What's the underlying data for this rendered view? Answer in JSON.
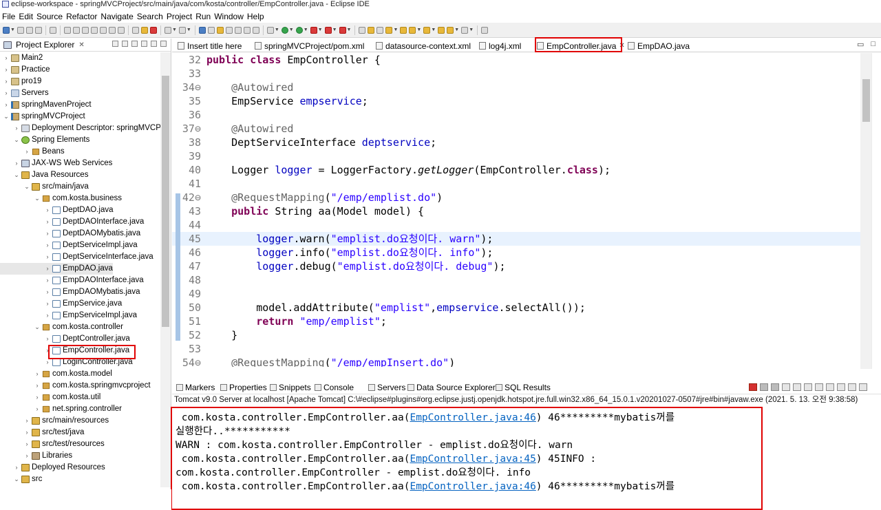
{
  "window": {
    "title": "eclipse-workspace - springMVCProject/src/main/java/com/kosta/controller/EmpController.java - Eclipse IDE"
  },
  "menu": [
    "File",
    "Edit",
    "Source",
    "Refactor",
    "Navigate",
    "Search",
    "Project",
    "Run",
    "Window",
    "Help"
  ],
  "explorer": {
    "tab_label": "Project Explorer",
    "items": [
      {
        "label": "Main2",
        "depth": 0,
        "twisty": "›",
        "icon": "proj"
      },
      {
        "label": "Practice",
        "depth": 0,
        "twisty": "›",
        "icon": "proj"
      },
      {
        "label": "pro19",
        "depth": 0,
        "twisty": "›",
        "icon": "proj"
      },
      {
        "label": "Servers",
        "depth": 0,
        "twisty": "›",
        "icon": "srv"
      },
      {
        "label": "springMavenProject",
        "depth": 0,
        "twisty": "›",
        "icon": "proj2"
      },
      {
        "label": "springMVCProject",
        "depth": 0,
        "twisty": "⌄",
        "icon": "proj2"
      },
      {
        "label": "Deployment Descriptor: springMVCPr",
        "depth": 1,
        "twisty": "›",
        "icon": "desc"
      },
      {
        "label": "Spring Elements",
        "depth": 1,
        "twisty": "⌄",
        "icon": "spr"
      },
      {
        "label": "Beans",
        "depth": 2,
        "twisty": "›",
        "icon": "pkg"
      },
      {
        "label": "JAX-WS Web Services",
        "depth": 1,
        "twisty": "›",
        "icon": "ws"
      },
      {
        "label": "Java Resources",
        "depth": 1,
        "twisty": "⌄",
        "icon": "src"
      },
      {
        "label": "src/main/java",
        "depth": 2,
        "twisty": "⌄",
        "icon": "src"
      },
      {
        "label": "com.kosta.business",
        "depth": 3,
        "twisty": "⌄",
        "icon": "pkg"
      },
      {
        "label": "DeptDAO.java",
        "depth": 4,
        "twisty": "›",
        "icon": "jv"
      },
      {
        "label": "DeptDAOInterface.java",
        "depth": 4,
        "twisty": "›",
        "icon": "jv"
      },
      {
        "label": "DeptDAOMybatis.java",
        "depth": 4,
        "twisty": "›",
        "icon": "jv"
      },
      {
        "label": "DeptServiceImpl.java",
        "depth": 4,
        "twisty": "›",
        "icon": "jv"
      },
      {
        "label": "DeptServiceInterface.java",
        "depth": 4,
        "twisty": "›",
        "icon": "jv"
      },
      {
        "label": "EmpDAO.java",
        "depth": 4,
        "twisty": "›",
        "icon": "jv",
        "selected": true
      },
      {
        "label": "EmpDAOInterface.java",
        "depth": 4,
        "twisty": "›",
        "icon": "jv"
      },
      {
        "label": "EmpDAOMybatis.java",
        "depth": 4,
        "twisty": "›",
        "icon": "jv"
      },
      {
        "label": "EmpService.java",
        "depth": 4,
        "twisty": "›",
        "icon": "jv"
      },
      {
        "label": "EmpServiceImpl.java",
        "depth": 4,
        "twisty": "›",
        "icon": "jv"
      },
      {
        "label": "com.kosta.controller",
        "depth": 3,
        "twisty": "⌄",
        "icon": "pkg"
      },
      {
        "label": "DeptController.java",
        "depth": 4,
        "twisty": "›",
        "icon": "jv"
      },
      {
        "label": "EmpController.java",
        "depth": 4,
        "twisty": "›",
        "icon": "jv",
        "boxed": true
      },
      {
        "label": "LoginController.java",
        "depth": 4,
        "twisty": "›",
        "icon": "jv"
      },
      {
        "label": "com.kosta.model",
        "depth": 3,
        "twisty": "›",
        "icon": "pkg"
      },
      {
        "label": "com.kosta.springmvcproject",
        "depth": 3,
        "twisty": "›",
        "icon": "pkg"
      },
      {
        "label": "com.kosta.util",
        "depth": 3,
        "twisty": "›",
        "icon": "pkg"
      },
      {
        "label": "net.spring.controller",
        "depth": 3,
        "twisty": "›",
        "icon": "pkg"
      },
      {
        "label": "src/main/resources",
        "depth": 2,
        "twisty": "›",
        "icon": "src"
      },
      {
        "label": "src/test/java",
        "depth": 2,
        "twisty": "›",
        "icon": "src"
      },
      {
        "label": "src/test/resources",
        "depth": 2,
        "twisty": "›",
        "icon": "src"
      },
      {
        "label": "Libraries",
        "depth": 2,
        "twisty": "›",
        "icon": "lib"
      },
      {
        "label": "Deployed Resources",
        "depth": 1,
        "twisty": "›",
        "icon": "src"
      },
      {
        "label": "src",
        "depth": 1,
        "twisty": "⌄",
        "icon": "src"
      }
    ]
  },
  "editor": {
    "tabs": [
      "Insert title here",
      "springMVCProject/pom.xml",
      "datasource-context.xml",
      "log4j.xml",
      "EmpController.java",
      "EmpDAO.java"
    ],
    "active_tab": "EmpController.java",
    "lines": [
      {
        "n": "32",
        "tokens": [
          [
            "kw",
            "public "
          ],
          [
            "kw",
            "class "
          ],
          [
            "",
            "EmpController {"
          ]
        ]
      },
      {
        "n": "33",
        "tokens": []
      },
      {
        "n": "34⊖",
        "tokens": [
          [
            "",
            "    "
          ],
          [
            "an",
            "@Autowired"
          ]
        ]
      },
      {
        "n": "35",
        "tokens": [
          [
            "",
            "    EmpService "
          ],
          [
            "fld",
            "empservice"
          ],
          [
            "",
            ";"
          ]
        ]
      },
      {
        "n": "36",
        "tokens": []
      },
      {
        "n": "37⊖",
        "tokens": [
          [
            "",
            "    "
          ],
          [
            "an",
            "@Autowired"
          ]
        ]
      },
      {
        "n": "38",
        "tokens": [
          [
            "",
            "    DeptServiceInterface "
          ],
          [
            "fld",
            "deptservice"
          ],
          [
            "",
            ";"
          ]
        ]
      },
      {
        "n": "39",
        "tokens": []
      },
      {
        "n": "40",
        "tokens": [
          [
            "",
            "    Logger "
          ],
          [
            "fld",
            "logger"
          ],
          [
            "",
            " = LoggerFactory."
          ],
          [
            "it",
            "getLogger"
          ],
          [
            "",
            "(EmpController."
          ],
          [
            "kw",
            "class"
          ],
          [
            "",
            ");"
          ]
        ]
      },
      {
        "n": "41",
        "tokens": []
      },
      {
        "n": "42⊖",
        "tokens": [
          [
            "",
            "    "
          ],
          [
            "an",
            "@RequestMapping"
          ],
          [
            "",
            "("
          ],
          [
            "st",
            "\"/emp/emplist.do\""
          ],
          [
            "",
            ")"
          ]
        ]
      },
      {
        "n": "43",
        "tokens": [
          [
            "",
            "    "
          ],
          [
            "kw",
            "public "
          ],
          [
            "",
            "String aa(Model model) {"
          ]
        ]
      },
      {
        "n": "44",
        "tokens": []
      },
      {
        "n": "45",
        "tokens": [
          [
            "",
            "        "
          ],
          [
            "fld",
            "logger"
          ],
          [
            "",
            ".warn("
          ],
          [
            "st",
            "\"emplist.do요청이다. warn\""
          ],
          [
            "",
            ");"
          ]
        ],
        "highlight": true
      },
      {
        "n": "46",
        "tokens": [
          [
            "",
            "        "
          ],
          [
            "fld",
            "logger"
          ],
          [
            "",
            ".info("
          ],
          [
            "st",
            "\"emplist.do요청이다. info\""
          ],
          [
            "",
            ");"
          ]
        ]
      },
      {
        "n": "47",
        "tokens": [
          [
            "",
            "        "
          ],
          [
            "fld",
            "logger"
          ],
          [
            "",
            ".debug("
          ],
          [
            "st",
            "\"emplist.do요청이다. debug\""
          ],
          [
            "",
            ");"
          ]
        ]
      },
      {
        "n": "48",
        "tokens": []
      },
      {
        "n": "49",
        "tokens": []
      },
      {
        "n": "50",
        "tokens": [
          [
            "",
            "        model.addAttribute("
          ],
          [
            "st",
            "\"emplist\""
          ],
          [
            "",
            ","
          ],
          [
            "fld",
            "empservice"
          ],
          [
            "",
            ".selectAll());"
          ]
        ]
      },
      {
        "n": "51",
        "tokens": [
          [
            "",
            "        "
          ],
          [
            "kw",
            "return "
          ],
          [
            "st",
            "\"emp/emplist\""
          ],
          [
            "",
            ";"
          ]
        ]
      },
      {
        "n": "52",
        "tokens": [
          [
            "",
            "    }"
          ]
        ]
      },
      {
        "n": "53",
        "tokens": []
      },
      {
        "n": "54⊖",
        "tokens": [
          [
            "",
            "    "
          ],
          [
            "an",
            "@RequestMapping"
          ],
          [
            "",
            "("
          ],
          [
            "st",
            "\"/emp/empInsert.do\""
          ],
          [
            "",
            ")"
          ]
        ]
      }
    ]
  },
  "console": {
    "tabs": [
      "Markers",
      "Properties",
      "Snippets",
      "Console",
      "Servers",
      "Data Source Explorer",
      "SQL Results"
    ],
    "description": "Tomcat v9.0 Server at localhost [Apache Tomcat] C:\\#eclipse#plugins#org.eclipse.justj.openjdk.hotspot.jre.full.win32.x86_64_15.0.1.v20201027-0507#jre#bin#javaw.exe  (2021. 5. 13. 오전 9:38:58)",
    "lines": [
      {
        "parts": [
          [
            "",
            " com.kosta.controller.EmpController.aa("
          ],
          [
            "lnk",
            "EmpController.java:46"
          ],
          [
            "",
            ") 46*********mybatis꺼를"
          ]
        ]
      },
      {
        "parts": [
          [
            "",
            "실행한다..***********"
          ]
        ]
      },
      {
        "parts": [
          [
            "",
            "WARN : com.kosta.controller.EmpController - emplist.do요청이다. warn"
          ]
        ]
      },
      {
        "parts": [
          [
            "",
            " com.kosta.controller.EmpController.aa("
          ],
          [
            "lnk",
            "EmpController.java:45"
          ],
          [
            "",
            ") 45INFO :"
          ]
        ]
      },
      {
        "parts": [
          [
            "",
            "com.kosta.controller.EmpController - emplist.do요청이다. info"
          ]
        ]
      },
      {
        "parts": [
          [
            "",
            " com.kosta.controller.EmpController.aa("
          ],
          [
            "lnk",
            "EmpController.java:46"
          ],
          [
            "",
            ") 46*********mybatis꺼를"
          ]
        ]
      }
    ]
  }
}
